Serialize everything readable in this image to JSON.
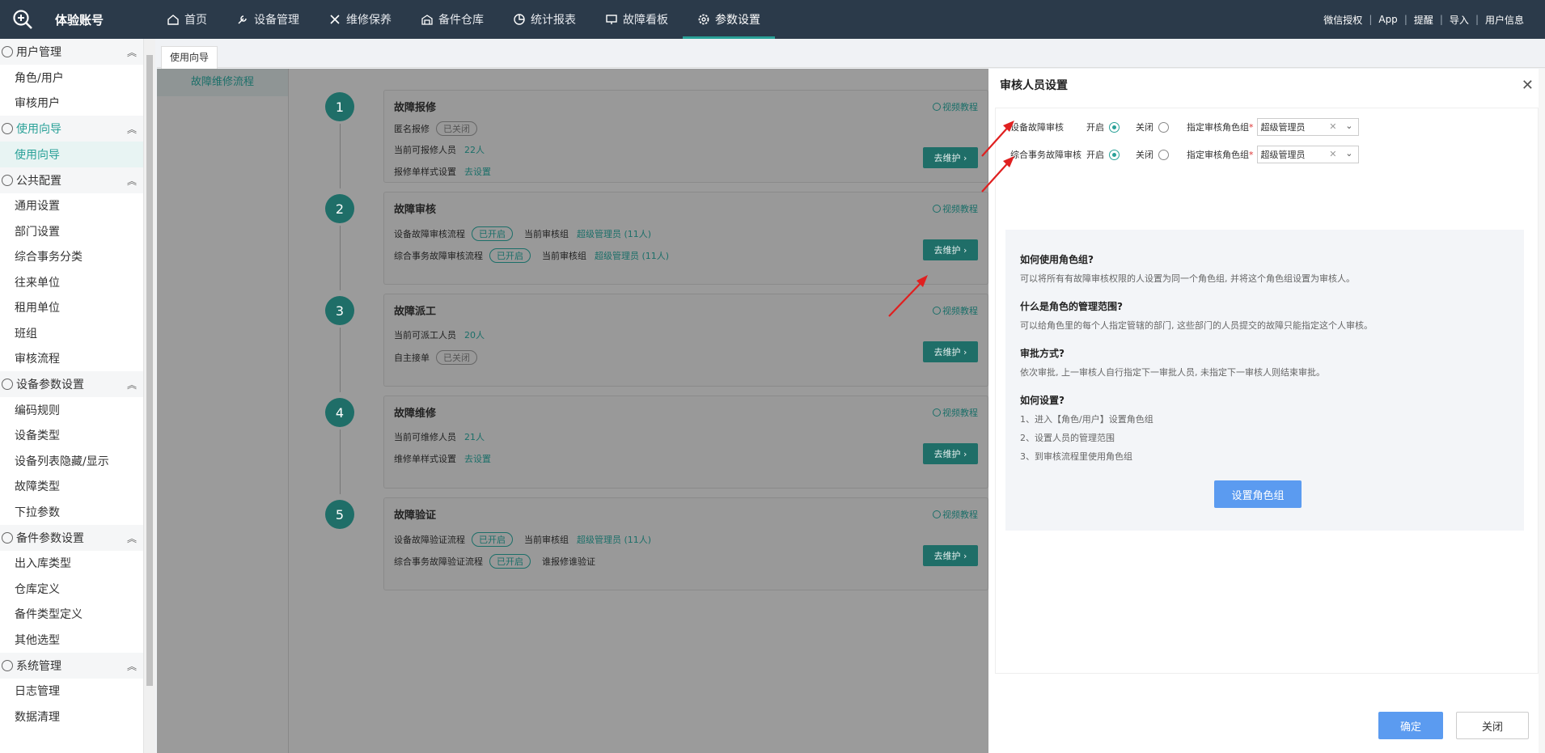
{
  "app": {
    "account": "体验账号"
  },
  "nav": [
    {
      "label": "首页",
      "icon": "home-icon"
    },
    {
      "label": "设备管理",
      "icon": "wrench-icon"
    },
    {
      "label": "维修保养",
      "icon": "tools-icon"
    },
    {
      "label": "备件仓库",
      "icon": "warehouse-icon"
    },
    {
      "label": "统计报表",
      "icon": "chart-icon"
    },
    {
      "label": "故障看板",
      "icon": "monitor-icon"
    },
    {
      "label": "参数设置",
      "icon": "gear-icon",
      "active": true
    }
  ],
  "toplinks": [
    "微信授权",
    "App",
    "提醒",
    "导入",
    "用户信息"
  ],
  "sidebar": {
    "groups": [
      {
        "label": "用户管理",
        "items": [
          "角色/用户",
          "审核用户"
        ]
      },
      {
        "label": "使用向导",
        "items": [
          "使用向导"
        ]
      },
      {
        "label": "公共配置",
        "items": [
          "通用设置",
          "部门设置",
          "综合事务分类",
          "往来单位",
          "租用单位",
          "班组",
          "审核流程"
        ]
      },
      {
        "label": "设备参数设置",
        "items": [
          "编码规则",
          "设备类型",
          "设备列表隐藏/显示",
          "故障类型",
          "下拉参数"
        ]
      },
      {
        "label": "备件参数设置",
        "items": [
          "出入库类型",
          "仓库定义",
          "备件类型定义",
          "其他选型"
        ]
      },
      {
        "label": "系统管理",
        "items": [
          "日志管理",
          "数据清理"
        ]
      }
    ]
  },
  "tab": "使用向导",
  "leftmenu": "故障维修流程",
  "steps": [
    {
      "num": "1",
      "title": "故障报修",
      "video": "视频教程",
      "btn": "去维护",
      "rows": [
        {
          "label": "匿名报修",
          "pill": "已关闭",
          "pill_on": false
        },
        {
          "label": "当前可报修人员",
          "link": "22人"
        },
        {
          "label": "报修单样式设置",
          "link": "去设置"
        }
      ]
    },
    {
      "num": "2",
      "title": "故障审核",
      "video": "视频教程",
      "btn": "去维护",
      "rows": [
        {
          "label": "设备故障审核流程",
          "pill": "已开启",
          "pill_on": true,
          "extra": "当前审核组",
          "link": "超级管理员 (11人)"
        },
        {
          "label": "综合事务故障审核流程",
          "pill": "已开启",
          "pill_on": true,
          "extra": "当前审核组",
          "link": "超级管理员 (11人)"
        }
      ]
    },
    {
      "num": "3",
      "title": "故障派工",
      "video": "视频教程",
      "btn": "去维护",
      "rows": [
        {
          "label": "当前可派工人员",
          "link": "20人"
        },
        {
          "label": "自主接单",
          "pill": "已关闭",
          "pill_on": false
        }
      ]
    },
    {
      "num": "4",
      "title": "故障维修",
      "video": "视频教程",
      "btn": "去维护",
      "rows": [
        {
          "label": "当前可维修人员",
          "link": "21人"
        },
        {
          "label": "维修单样式设置",
          "link": "去设置"
        }
      ]
    },
    {
      "num": "5",
      "title": "故障验证",
      "video": "视频教程",
      "btn": "去维护",
      "rows": [
        {
          "label": "设备故障验证流程",
          "pill": "已开启",
          "pill_on": true,
          "extra": "当前审核组",
          "link": "超级管理员 (11人)"
        },
        {
          "label": "综合事务故障验证流程",
          "pill": "已开启",
          "pill_on": true,
          "extra": "谁报修谁验证"
        }
      ]
    }
  ],
  "panel": {
    "title": "审核人员设置",
    "settings": [
      {
        "label": "设备故障审核",
        "on": "开启",
        "off": "关闭",
        "group_label": "指定审核角色组",
        "value": "超级管理员"
      },
      {
        "label": "综合事务故障审核",
        "on": "开启",
        "off": "关闭",
        "group_label": "指定审核角色组",
        "value": "超级管理员"
      }
    ],
    "help": [
      {
        "h": "如何使用角色组?",
        "p": [
          "可以将所有有故障审核权限的人设置为同一个角色组, 并将这个角色组设置为审核人。"
        ]
      },
      {
        "h": "什么是角色的管理范围?",
        "p": [
          "可以给角色里的每个人指定管辖的部门, 这些部门的人员提交的故障只能指定这个人审核。"
        ]
      },
      {
        "h": "审批方式?",
        "p": [
          "依次审批, 上一审核人自行指定下一审批人员, 未指定下一审核人则结束审批。"
        ]
      },
      {
        "h": "如何设置?",
        "p": [
          "1、进入【角色/用户】设置角色组",
          "2、设置人员的管理范围",
          "3、到审核流程里使用角色组"
        ]
      }
    ],
    "cta": "设置角色组",
    "ok": "确定",
    "cancel": "关闭"
  }
}
